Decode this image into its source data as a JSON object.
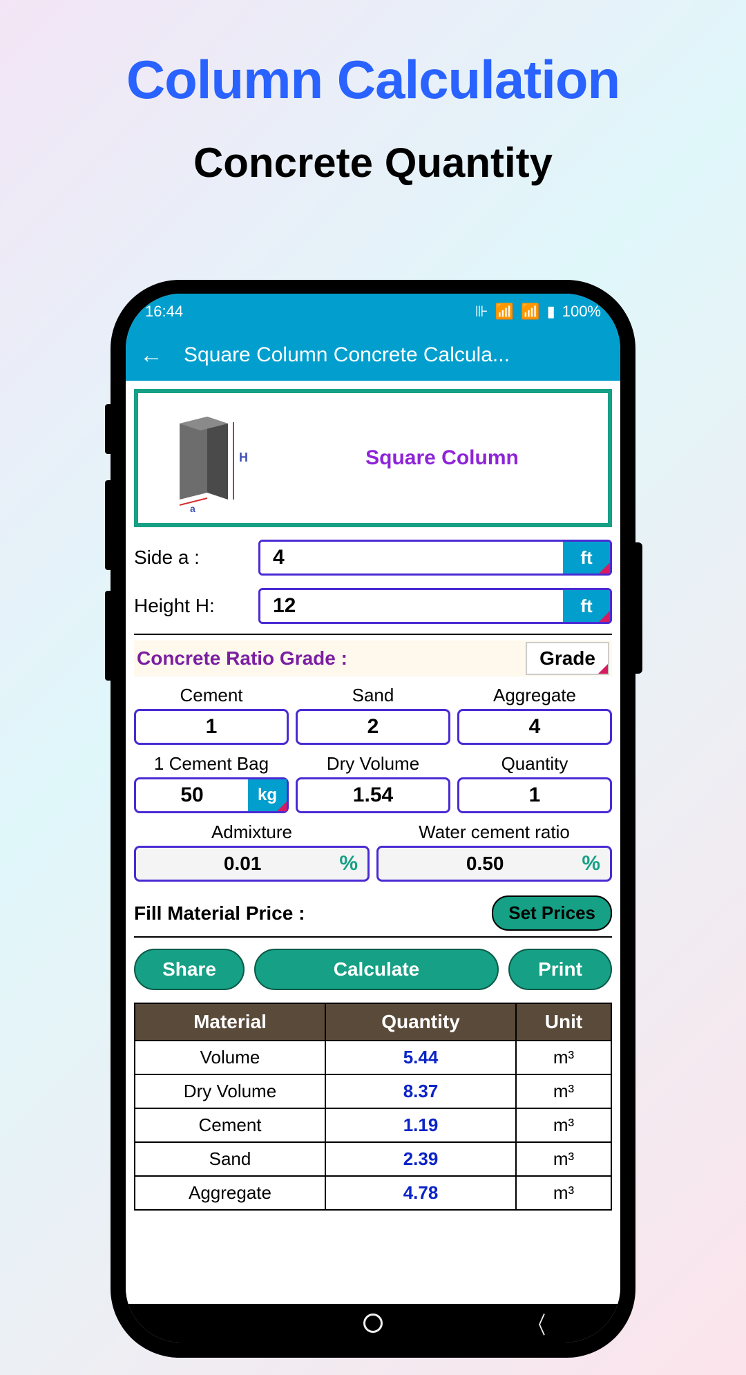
{
  "hero": {
    "title": "Column Calculation",
    "subtitle": "Concrete Quantity"
  },
  "statusbar": {
    "time": "16:44",
    "battery": "100%"
  },
  "appbar": {
    "title": "Square Column Concrete Calcula..."
  },
  "diagram": {
    "label": "Square Column"
  },
  "inputs": {
    "side_a": {
      "label": "Side a :",
      "value": "4",
      "unit": "ft"
    },
    "height": {
      "label": "Height H:",
      "value": "12",
      "unit": "ft"
    }
  },
  "ratio": {
    "label": "Concrete Ratio Grade :",
    "grade_btn": "Grade",
    "cement": {
      "header": "Cement",
      "value": "1"
    },
    "sand": {
      "header": "Sand",
      "value": "2"
    },
    "aggregate": {
      "header": "Aggregate",
      "value": "4"
    },
    "bag": {
      "header": "1 Cement Bag",
      "value": "50",
      "unit": "kg"
    },
    "dry_volume": {
      "header": "Dry Volume",
      "value": "1.54"
    },
    "quantity": {
      "header": "Quantity",
      "value": "1"
    },
    "admixture": {
      "header": "Admixture",
      "value": "0.01",
      "unit": "%"
    },
    "wcr": {
      "header": "Water cement ratio",
      "value": "0.50",
      "unit": "%"
    }
  },
  "price": {
    "label": "Fill Material Price :",
    "button": "Set Prices"
  },
  "actions": {
    "share": "Share",
    "calculate": "Calculate",
    "print": "Print"
  },
  "table": {
    "headers": {
      "material": "Material",
      "quantity": "Quantity",
      "unit": "Unit"
    },
    "rows": [
      {
        "m": "Volume",
        "q": "5.44",
        "u": "m³"
      },
      {
        "m": "Dry Volume",
        "q": "8.37",
        "u": "m³"
      },
      {
        "m": "Cement",
        "q": "1.19",
        "u": "m³"
      },
      {
        "m": "Sand",
        "q": "2.39",
        "u": "m³"
      },
      {
        "m": "Aggregate",
        "q": "4.78",
        "u": "m³"
      }
    ]
  }
}
